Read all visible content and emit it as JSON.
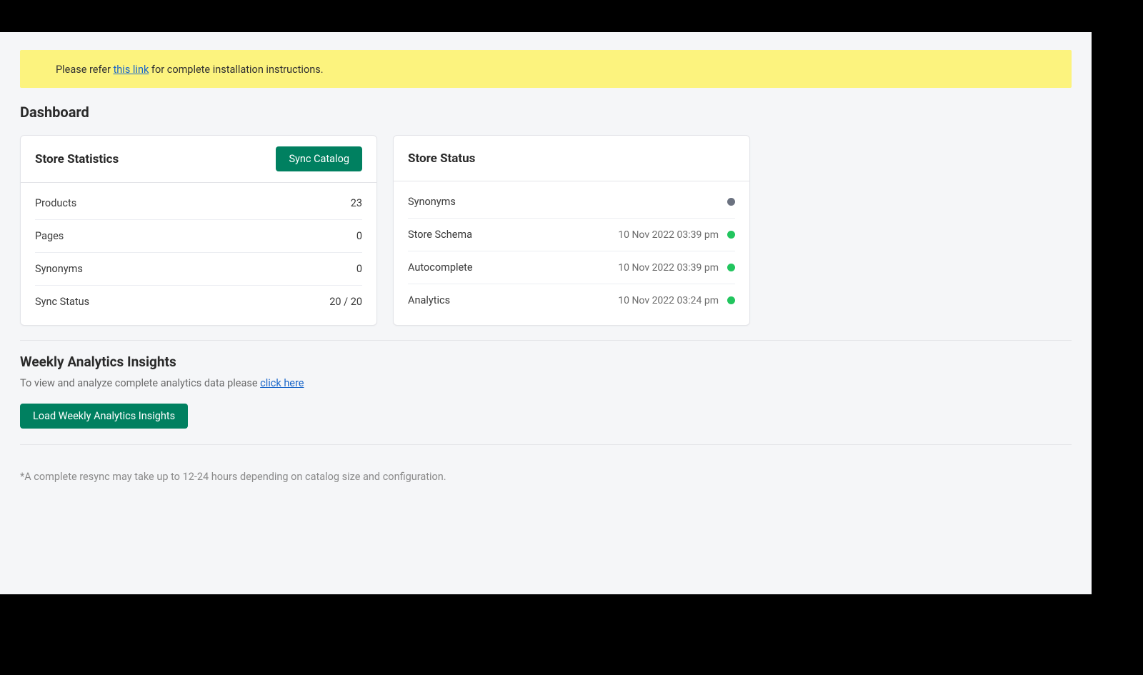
{
  "alert": {
    "prefix": "Please refer ",
    "link_text": "this link",
    "suffix": " for complete installation instructions."
  },
  "page_title": "Dashboard",
  "store_statistics": {
    "title": "Store Statistics",
    "sync_button": "Sync Catalog",
    "rows": [
      {
        "label": "Products",
        "value": "23"
      },
      {
        "label": "Pages",
        "value": "0"
      },
      {
        "label": "Synonyms",
        "value": "0"
      },
      {
        "label": "Sync Status",
        "value": "20 / 20"
      }
    ]
  },
  "store_status": {
    "title": "Store Status",
    "rows": [
      {
        "label": "Synonyms",
        "time": "",
        "dot": "gray"
      },
      {
        "label": "Store Schema",
        "time": "10 Nov 2022 03:39 pm",
        "dot": "green"
      },
      {
        "label": "Autocomplete",
        "time": "10 Nov 2022 03:39 pm",
        "dot": "green"
      },
      {
        "label": "Analytics",
        "time": "10 Nov 2022 03:24 pm",
        "dot": "green"
      }
    ]
  },
  "analytics": {
    "title": "Weekly Analytics Insights",
    "sub_prefix": "To view and analyze complete analytics data please ",
    "sub_link": "click here",
    "load_button": "Load Weekly Analytics Insights"
  },
  "footnote": "*A complete resync may take up to 12-24 hours depending on catalog size and configuration."
}
